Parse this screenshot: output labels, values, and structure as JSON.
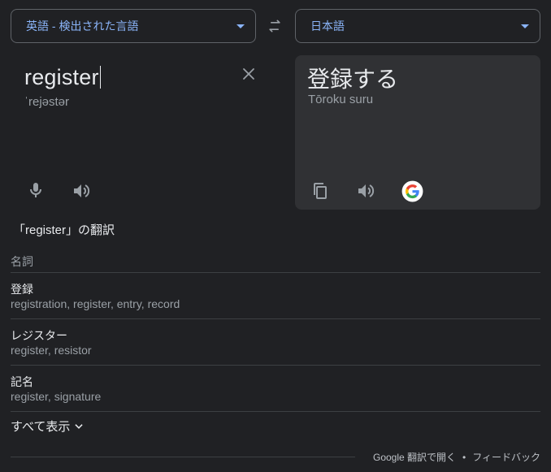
{
  "source_lang": {
    "label": "英語 - 検出された言語"
  },
  "target_lang": {
    "label": "日本語"
  },
  "source": {
    "text": "register",
    "phonetic": "ˈrejəstər"
  },
  "target": {
    "text": "登録する",
    "romanization": "Tōroku suru"
  },
  "dictionary": {
    "title": "「register」の翻訳",
    "part_of_speech": "名詞",
    "entries": [
      {
        "word": "登録",
        "synonyms": "registration, register, entry, record"
      },
      {
        "word": "レジスター",
        "synonyms": "register, resistor"
      },
      {
        "word": "記名",
        "synonyms": "register, signature"
      }
    ],
    "show_all": "すべて表示"
  },
  "footer": {
    "open_link": "Google 翻訳で開く",
    "separator": "•",
    "feedback": "フィードバック"
  },
  "icons": {
    "swap": "swap-icon",
    "clear": "close-icon",
    "mic": "microphone-icon",
    "speaker": "speaker-icon",
    "copy": "copy-icon",
    "google": "google-g-logo",
    "chevron": "chevron-down-icon"
  },
  "colors": {
    "accent": "#8ab4f8",
    "background": "#202124",
    "panel": "#303134"
  }
}
